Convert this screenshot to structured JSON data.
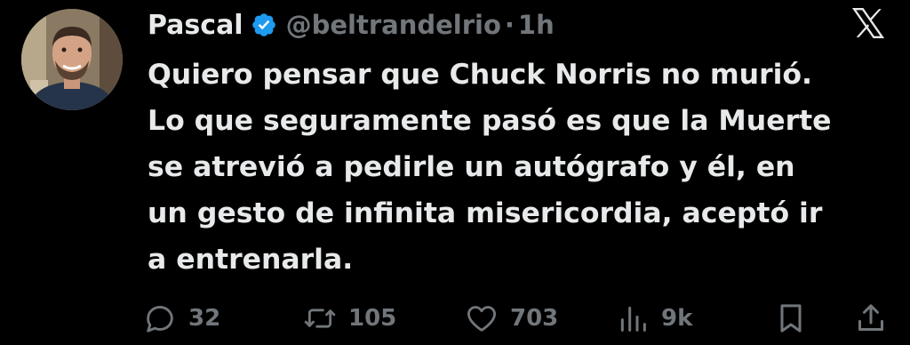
{
  "author": {
    "name": "Pascal",
    "handle": "@beltrandelrio",
    "separator": "·",
    "time": "1h"
  },
  "tweet": {
    "lines": [
      "Quiero pensar que Chuck Norris no murió.",
      "Lo que seguramente pasó es que la Muerte",
      "se atrevió a pedirle un autógrafo y él, en",
      "un gesto de infinita misericordia, aceptó ir",
      "a entrenarla."
    ]
  },
  "actions": {
    "replies": "32",
    "retweets": "105",
    "likes": "703",
    "views": "9k"
  },
  "colors": {
    "background": "#000000",
    "text": "#e7e9ea",
    "muted": "#71767b",
    "verified": "#1d9bf0"
  },
  "icons": [
    "verified-badge-icon",
    "x-logo-icon",
    "reply-icon",
    "retweet-icon",
    "like-icon",
    "views-icon",
    "bookmark-icon",
    "share-icon"
  ]
}
